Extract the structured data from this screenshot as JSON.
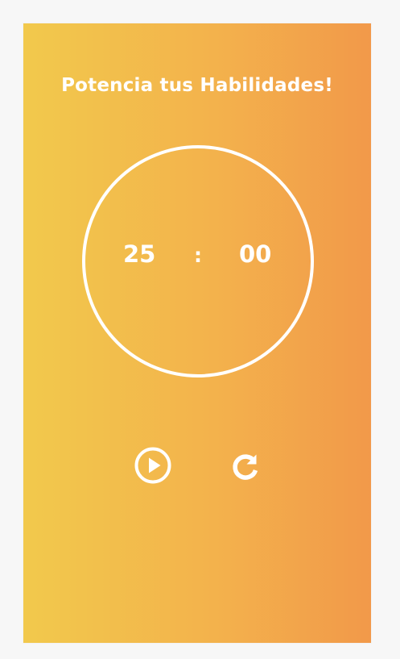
{
  "header": {
    "title": "Potencia tus Habilidades!"
  },
  "timer": {
    "minutes": "25",
    "separator": ":",
    "seconds": "00"
  },
  "controls": {
    "play_icon": "play-circle-icon",
    "reset_icon": "reset-arrow-icon"
  },
  "colors": {
    "gradient_start": "#f2c94c",
    "gradient_end": "#f2994a",
    "foreground": "#ffffff"
  }
}
